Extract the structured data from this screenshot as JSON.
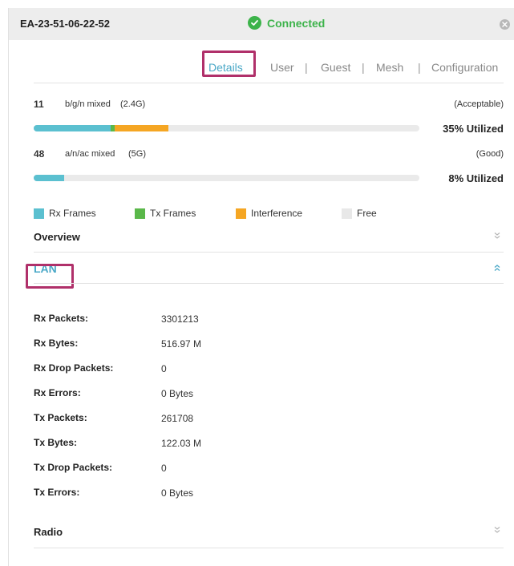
{
  "header": {
    "device_name": "EA-23-51-06-22-52",
    "status": "Connected",
    "status_color": "#3cb34a"
  },
  "tabs": [
    {
      "label": "Details",
      "active": true
    },
    {
      "label": "User",
      "active": false
    },
    {
      "label": "Guest",
      "active": false
    },
    {
      "label": "Mesh",
      "active": false
    },
    {
      "label": "Configuration",
      "active": false
    }
  ],
  "radios": [
    {
      "channel": "11",
      "mode": "b/g/n mixed",
      "band": "(2.4G)",
      "quality": "(Acceptable)",
      "utilization": "35% Utilized",
      "segments": [
        {
          "name": "Rx Frames",
          "percent": 20
        },
        {
          "name": "Tx Frames",
          "percent": 1
        },
        {
          "name": "Interference",
          "percent": 14
        }
      ]
    },
    {
      "channel": "48",
      "mode": "a/n/ac mixed",
      "band": "(5G)",
      "quality": "(Good)",
      "utilization": "8% Utilized",
      "segments": [
        {
          "name": "Rx Frames",
          "percent": 8
        }
      ]
    }
  ],
  "legend": [
    {
      "label": "Rx Frames",
      "color": "#5bc0d0"
    },
    {
      "label": "Tx Frames",
      "color": "#5ab84a"
    },
    {
      "label": "Interference",
      "color": "#f5a623"
    },
    {
      "label": "Free",
      "color": "#e8e8e8"
    }
  ],
  "sections": {
    "overview": "Overview",
    "lan": "LAN",
    "radio": "Radio"
  },
  "lan_stats": [
    {
      "label": "Rx Packets:",
      "value": "3301213"
    },
    {
      "label": "Rx Bytes:",
      "value": "516.97 M"
    },
    {
      "label": "Rx Drop Packets:",
      "value": "0"
    },
    {
      "label": "Rx Errors:",
      "value": "0 Bytes"
    },
    {
      "label": "Tx Packets:",
      "value": "261708"
    },
    {
      "label": "Tx Bytes:",
      "value": "122.03 M"
    },
    {
      "label": "Tx Drop Packets:",
      "value": "0"
    },
    {
      "label": "Tx Errors:",
      "value": "0 Bytes"
    }
  ],
  "colors": {
    "accent": "#4aa8c7",
    "highlight": "#b0306a"
  }
}
